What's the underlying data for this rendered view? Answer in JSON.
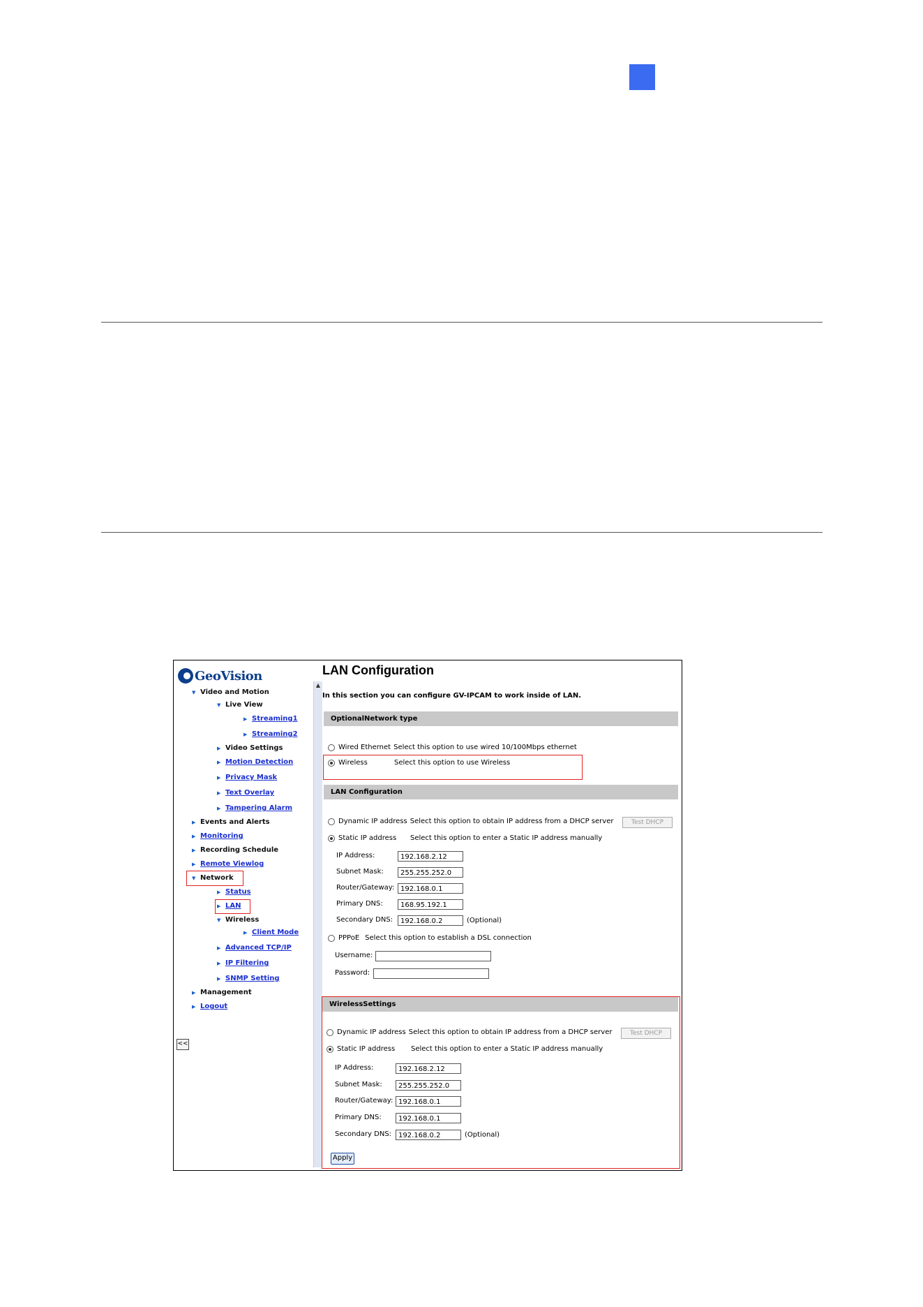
{
  "nav": {
    "logo": "GeoVision",
    "collapse_label": "<<",
    "items": [
      {
        "label": "Video and Motion",
        "link": false
      },
      {
        "label": "Live View",
        "link": false
      },
      {
        "label": "Streaming1",
        "link": true
      },
      {
        "label": "Streaming2",
        "link": true
      },
      {
        "label": "Video Settings",
        "link": false
      },
      {
        "label": "Motion Detection",
        "link": true
      },
      {
        "label": "Privacy Mask",
        "link": true
      },
      {
        "label": "Text Overlay",
        "link": true
      },
      {
        "label": "Tampering Alarm",
        "link": true
      },
      {
        "label": "Events and Alerts",
        "link": false
      },
      {
        "label": "Monitoring",
        "link": true
      },
      {
        "label": "Recording Schedule",
        "link": false
      },
      {
        "label": "Remote Viewlog",
        "link": true
      },
      {
        "label": "Network",
        "link": false
      },
      {
        "label": "Status",
        "link": true
      },
      {
        "label": "LAN",
        "link": true
      },
      {
        "label": "Wireless",
        "link": false
      },
      {
        "label": "Client Mode",
        "link": true
      },
      {
        "label": "Advanced TCP/IP",
        "link": true
      },
      {
        "label": "IP Filtering",
        "link": true
      },
      {
        "label": "SNMP Setting",
        "link": true
      },
      {
        "label": "Management",
        "link": false
      },
      {
        "label": "Logout",
        "link": true
      }
    ]
  },
  "content": {
    "title": "LAN Configuration",
    "intro": "In this section you can configure GV-IPCAM to work inside of LAN.",
    "network_type": {
      "header": "OptionalNetwork type",
      "wired": {
        "label": "Wired Ethernet",
        "desc": "Select this option to use wired 10/100Mbps ethernet"
      },
      "wireless": {
        "label": "Wireless",
        "desc": "Select this option to use Wireless"
      }
    },
    "lan": {
      "header": "LAN Configuration",
      "dynamic": {
        "label": "Dynamic IP address",
        "desc": "Select this option to obtain IP address from a DHCP server",
        "button": "Test DHCP"
      },
      "static": {
        "label": "Static IP address",
        "desc": "Select this option to enter a Static IP address manually"
      },
      "fields": {
        "ip_label": "IP Address:",
        "ip": "192.168.2.12",
        "mask_label": "Subnet Mask:",
        "mask": "255.255.252.0",
        "gw_label": "Router/Gateway:",
        "gw": "192.168.0.1",
        "dns1_label": "Primary DNS:",
        "dns1": "168.95.192.1",
        "dns2_label": "Secondary DNS:",
        "dns2": "192.168.0.2",
        "optional": "(Optional)"
      },
      "pppoe": {
        "label": "PPPoE",
        "desc": "Select this option to establish a DSL connection",
        "user_label": "Username:",
        "pass_label": "Password:"
      }
    },
    "wireless": {
      "header": "WirelessSettings",
      "dynamic": {
        "label": "Dynamic IP address",
        "desc": "Select this option to obtain IP address from a DHCP server",
        "button": "Test DHCP"
      },
      "static": {
        "label": "Static IP address",
        "desc": "Select this option to enter a Static IP address manually"
      },
      "fields": {
        "ip_label": "IP Address:",
        "ip": "192.168.2.12",
        "mask_label": "Subnet Mask:",
        "mask": "255.255.252.0",
        "gw_label": "Router/Gateway:",
        "gw": "192.168.0.1",
        "dns1_label": "Primary DNS:",
        "dns1": "192.168.0.1",
        "dns2_label": "Secondary DNS:",
        "dns2": "192.168.0.2",
        "optional": "(Optional)"
      }
    },
    "apply": "Apply"
  }
}
